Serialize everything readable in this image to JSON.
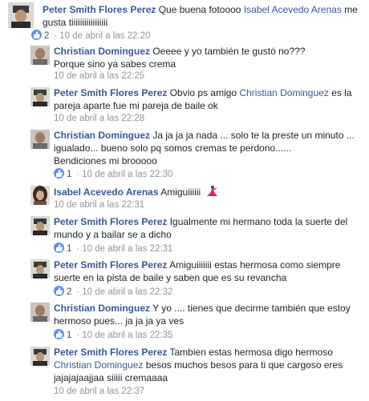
{
  "comments": [
    {
      "author": "Peter Smith Flores Perez",
      "text_before": " Que buena fotoooo ",
      "mention": "Isabel Acevedo Arenas",
      "text_after": " me gusta tiiiiiiiiiiiiiiiii",
      "likes": "2",
      "time": "10 de abril a las 22:20"
    },
    {
      "author": "Christian Dominguez",
      "text_before": " Oeeee y yo también te gustó no???",
      "line2": "Porque sino ya sabes crema",
      "time": "10 de abril a las 22:25"
    },
    {
      "author": "Peter Smith Flores Perez",
      "text_before": " Obvio ps amigo ",
      "mention": "Christian Dominguez",
      "text_after": " es la",
      "line2": "pareja aparte fue mi pareja de baile ok",
      "time": "10 de abril a las 22:28"
    },
    {
      "author": "Christian Dominguez",
      "text_before": " Ja ja ja ja nada ... solo te la preste un minuto ...",
      "line2": "igualado... bueno solo pq somos cremas te perdono......",
      "line3": "Bendiciones mi brooooo",
      "likes": "1",
      "time": "10 de abril a las 22:30"
    },
    {
      "author": "Isabel Acevedo Arenas",
      "text_before": " Amiguiiiiii",
      "time": "10 de abril a las 22:31"
    },
    {
      "author": "Peter Smith Flores Perez",
      "text_before": " Igualmente mi hermano toda la suerte del",
      "line2": "mundo y a bailar se a dicho",
      "likes": "1",
      "time": "10 de abril a las 22:31"
    },
    {
      "author": "Peter Smith Flores Perez",
      "text_before": " Amiguiiiiiii estas hermosa como siempre",
      "line2": "suerte en la pista de baile y saben que es su revancha",
      "likes": "2",
      "time": "10 de abril a las 22:32"
    },
    {
      "author": "Christian Dominguez",
      "text_before": " Y yo .... tienes que decirme también que estoy",
      "line2": "hermoso pues... ja ja ja ya ves",
      "likes": "1",
      "time": "10 de abril a las 22:35"
    },
    {
      "author": "Peter Smith Flores Perez",
      "text_before": " Tambien estas hermosa digo hermoso",
      "mention": "Christian Dominguez",
      "text_after": " besos muchos besos para ti que cargoso eres",
      "line2": "jajajajaajjaa siiiii cremaaaa",
      "time": "10 de abril a las 22:37"
    }
  ],
  "colors": {
    "name": "#365899",
    "meta": "#90949c",
    "like_badge": "#5890ff"
  },
  "icons": [
    "like-icon",
    "dancer-emoji",
    "avatar-photo"
  ]
}
